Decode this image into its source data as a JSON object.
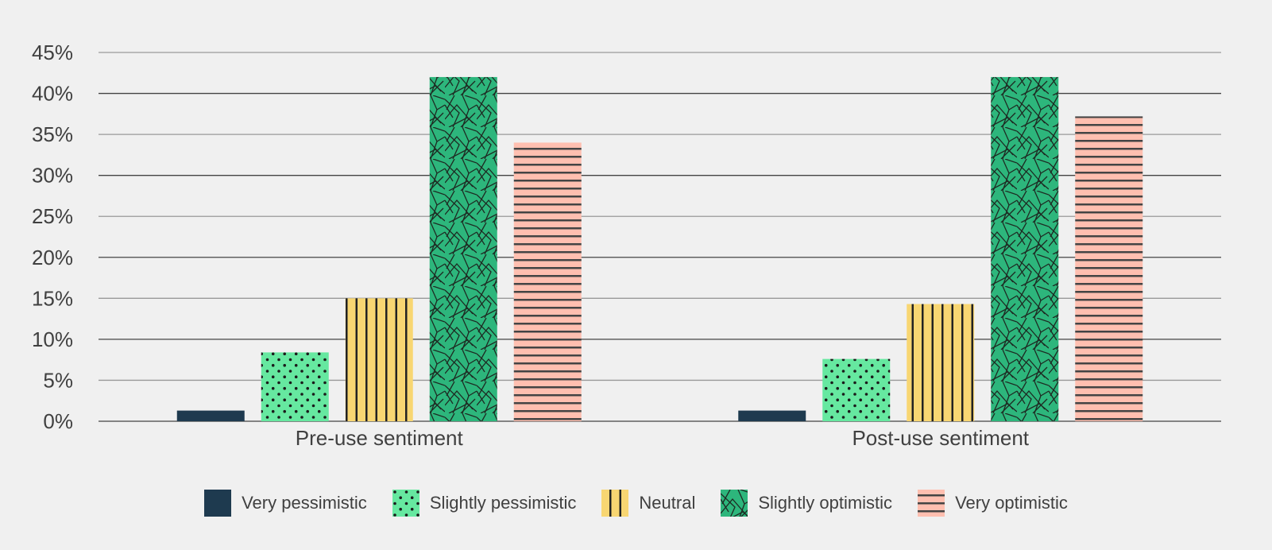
{
  "chart_data": {
    "type": "bar",
    "title": "",
    "xlabel": "",
    "ylabel": "",
    "ylim": [
      0,
      45
    ],
    "yticks": [
      0,
      5,
      10,
      15,
      20,
      25,
      30,
      35,
      40,
      45
    ],
    "ytick_labels": [
      "0%",
      "5%",
      "10%",
      "15%",
      "20%",
      "25%",
      "30%",
      "35%",
      "40%",
      "45%"
    ],
    "grid": true,
    "legend_position": "bottom",
    "categories": [
      "Pre-use sentiment",
      "Post-use sentiment"
    ],
    "series": [
      {
        "name": "Very pessimistic",
        "values": [
          1.3,
          1.3
        ],
        "color": "#1e3a4f",
        "pattern": "solid"
      },
      {
        "name": "Slightly pessimistic",
        "values": [
          8.4,
          7.6
        ],
        "color": "#66e8a0",
        "pattern": "dots"
      },
      {
        "name": "Neutral",
        "values": [
          15,
          14.3
        ],
        "color": "#f8d672",
        "pattern": "vertical-lines"
      },
      {
        "name": "Slightly optimistic",
        "values": [
          42,
          42
        ],
        "color": "#2db67c",
        "pattern": "scribble"
      },
      {
        "name": "Very optimistic",
        "values": [
          34,
          37.2
        ],
        "color": "#ffbfb0",
        "pattern": "horizontal-lines"
      }
    ]
  }
}
